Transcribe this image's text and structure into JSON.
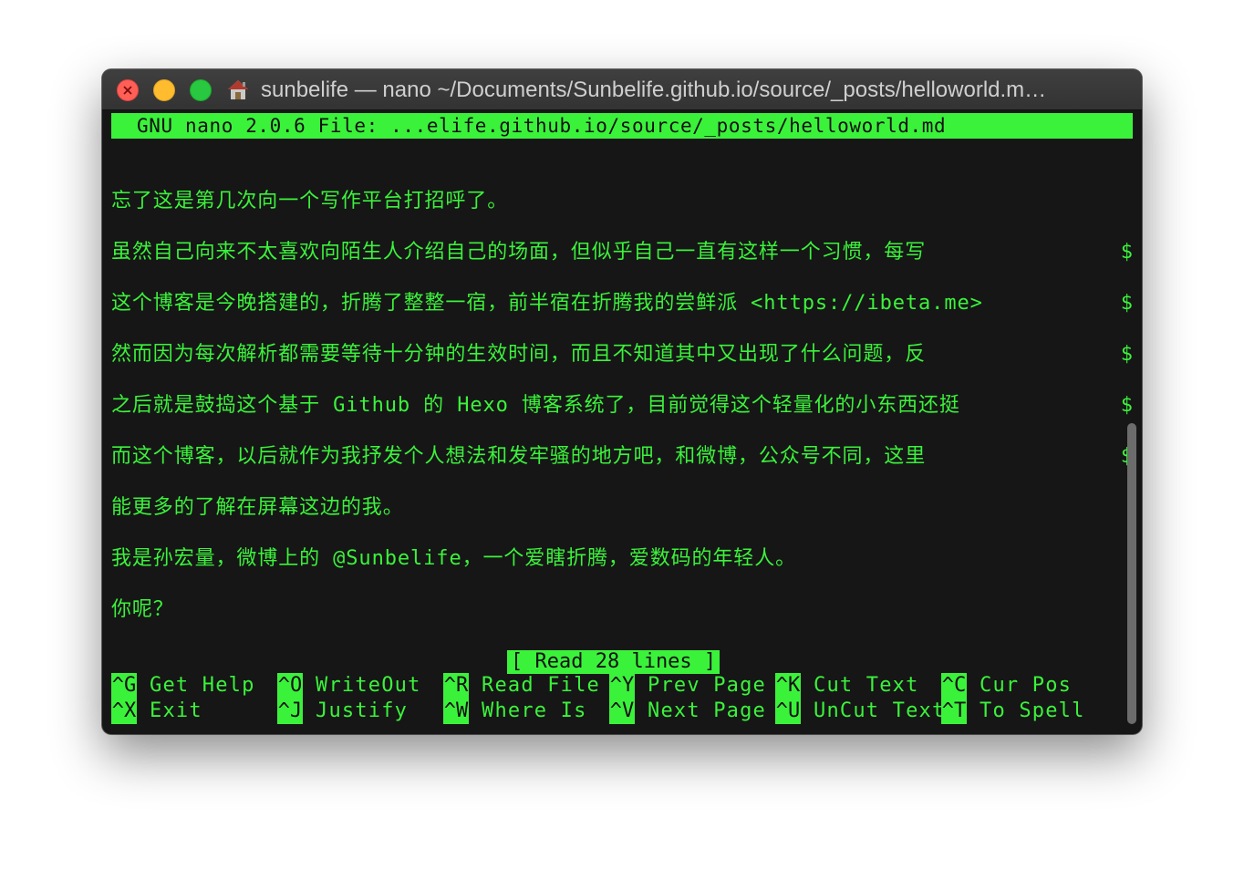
{
  "window": {
    "title": "sunbelife — nano ~/Documents/Sunbelife.github.io/source/_posts/helloworld.m…"
  },
  "nano": {
    "header": "GNU nano 2.0.6 File: ...elife.github.io/source/_posts/helloworld.md",
    "lines": [
      "忘了这是第几次向一个写作平台打招呼了。",
      "虽然自己向来不太喜欢向陌生人介绍自己的场面，但似乎自己一直有这样一个习惯，每写",
      "这个博客是今晚搭建的，折腾了整整一宿，前半宿在折腾我的尝鲜派 <https://ibeta.me>",
      "然而因为每次解析都需要等待十分钟的生效时间，而且不知道其中又出现了什么问题，反",
      "之后就是鼓捣这个基于 Github 的 Hexo 博客系统了，目前觉得这个轻量化的小东西还挺",
      "而这个博客，以后就作为我抒发个人想法和发牢骚的地方吧，和微博，公众号不同，这里",
      "能更多的了解在屏幕这边的我。",
      "我是孙宏量，微博上的 @Sunbelife，一个爱瞎折腾，爱数码的年轻人。",
      "你呢？"
    ],
    "overflow_marker": "$",
    "status": "[ Read 28 lines ]",
    "shortcuts_row1": [
      {
        "key": "^G",
        "label": "Get Help"
      },
      {
        "key": "^O",
        "label": "WriteOut"
      },
      {
        "key": "^R",
        "label": "Read File"
      },
      {
        "key": "^Y",
        "label": "Prev Page"
      },
      {
        "key": "^K",
        "label": "Cut Text"
      },
      {
        "key": "^C",
        "label": "Cur Pos"
      }
    ],
    "shortcuts_row2": [
      {
        "key": "^X",
        "label": "Exit"
      },
      {
        "key": "^J",
        "label": "Justify"
      },
      {
        "key": "^W",
        "label": "Where Is"
      },
      {
        "key": "^V",
        "label": "Next Page"
      },
      {
        "key": "^U",
        "label": "UnCut Text"
      },
      {
        "key": "^T",
        "label": "To Spell"
      }
    ]
  },
  "colors": {
    "terminal_fg": "#3bf23b",
    "terminal_bg": "#161616",
    "close": "#ff5f57",
    "minimize": "#febc2e",
    "maximize": "#28c840"
  }
}
